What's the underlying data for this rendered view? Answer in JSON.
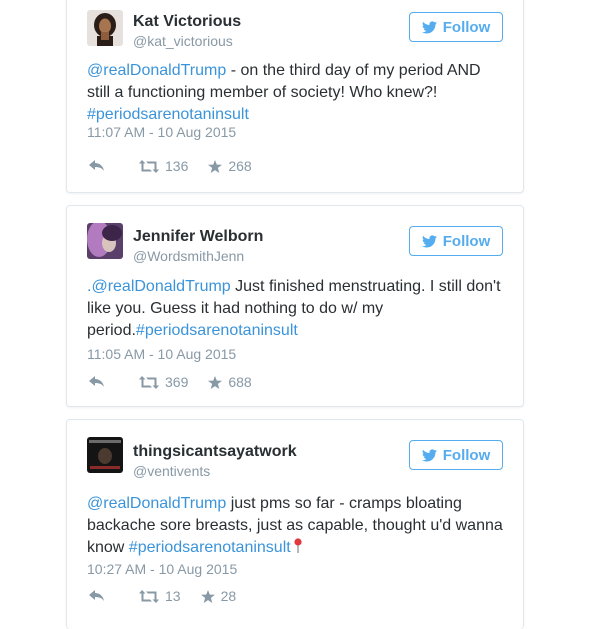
{
  "tweets": [
    {
      "name": "Kat Victorious",
      "handle": "@kat_victorious",
      "follow_label": "Follow",
      "text": [
        {
          "t": "@realDonaldTrump",
          "link": true
        },
        {
          "t": " - on the third day of my period AND still a functioning member of society! Who knew?! ",
          "link": false
        },
        {
          "t": "#periodsarenotaninsult",
          "link": true
        }
      ],
      "time": "11:07 AM - 10 Aug 2015",
      "retweets": "136",
      "favorites": "268"
    },
    {
      "name": "Jennifer Welborn",
      "handle": "@WordsmithJenn",
      "follow_label": "Follow",
      "text": [
        {
          "t": ".@realDonaldTrump",
          "link": true
        },
        {
          "t": " Just finished menstruating.  I still don't like you. Guess it  had nothing to do w/ my period.",
          "link": false
        },
        {
          "t": "#periodsarenotaninsult",
          "link": true
        }
      ],
      "time": "11:05 AM - 10 Aug 2015",
      "retweets": "369",
      "favorites": "688"
    },
    {
      "name": "thingsicantsayatwork",
      "handle": "@ventivents",
      "follow_label": "Follow",
      "text": [
        {
          "t": "@realDonaldTrump",
          "link": true
        },
        {
          "t": " just pms so far - cramps bloating backache sore breasts, just as capable, thought u'd wanna know ",
          "link": false
        },
        {
          "t": "#periodsarenotaninsult",
          "link": true
        }
      ],
      "time": "10:27 AM - 10 Aug 2015",
      "retweets": "13",
      "favorites": "28"
    }
  ],
  "colors": {
    "accent": "#55acee",
    "link": "#3b94d9",
    "text": "#292f33",
    "muted": "#8899a6",
    "border": "#e1e8ed"
  },
  "icons": [
    "twitter-bird-icon",
    "reply-icon",
    "retweet-icon",
    "favorite-star-icon",
    "pin-icon"
  ]
}
